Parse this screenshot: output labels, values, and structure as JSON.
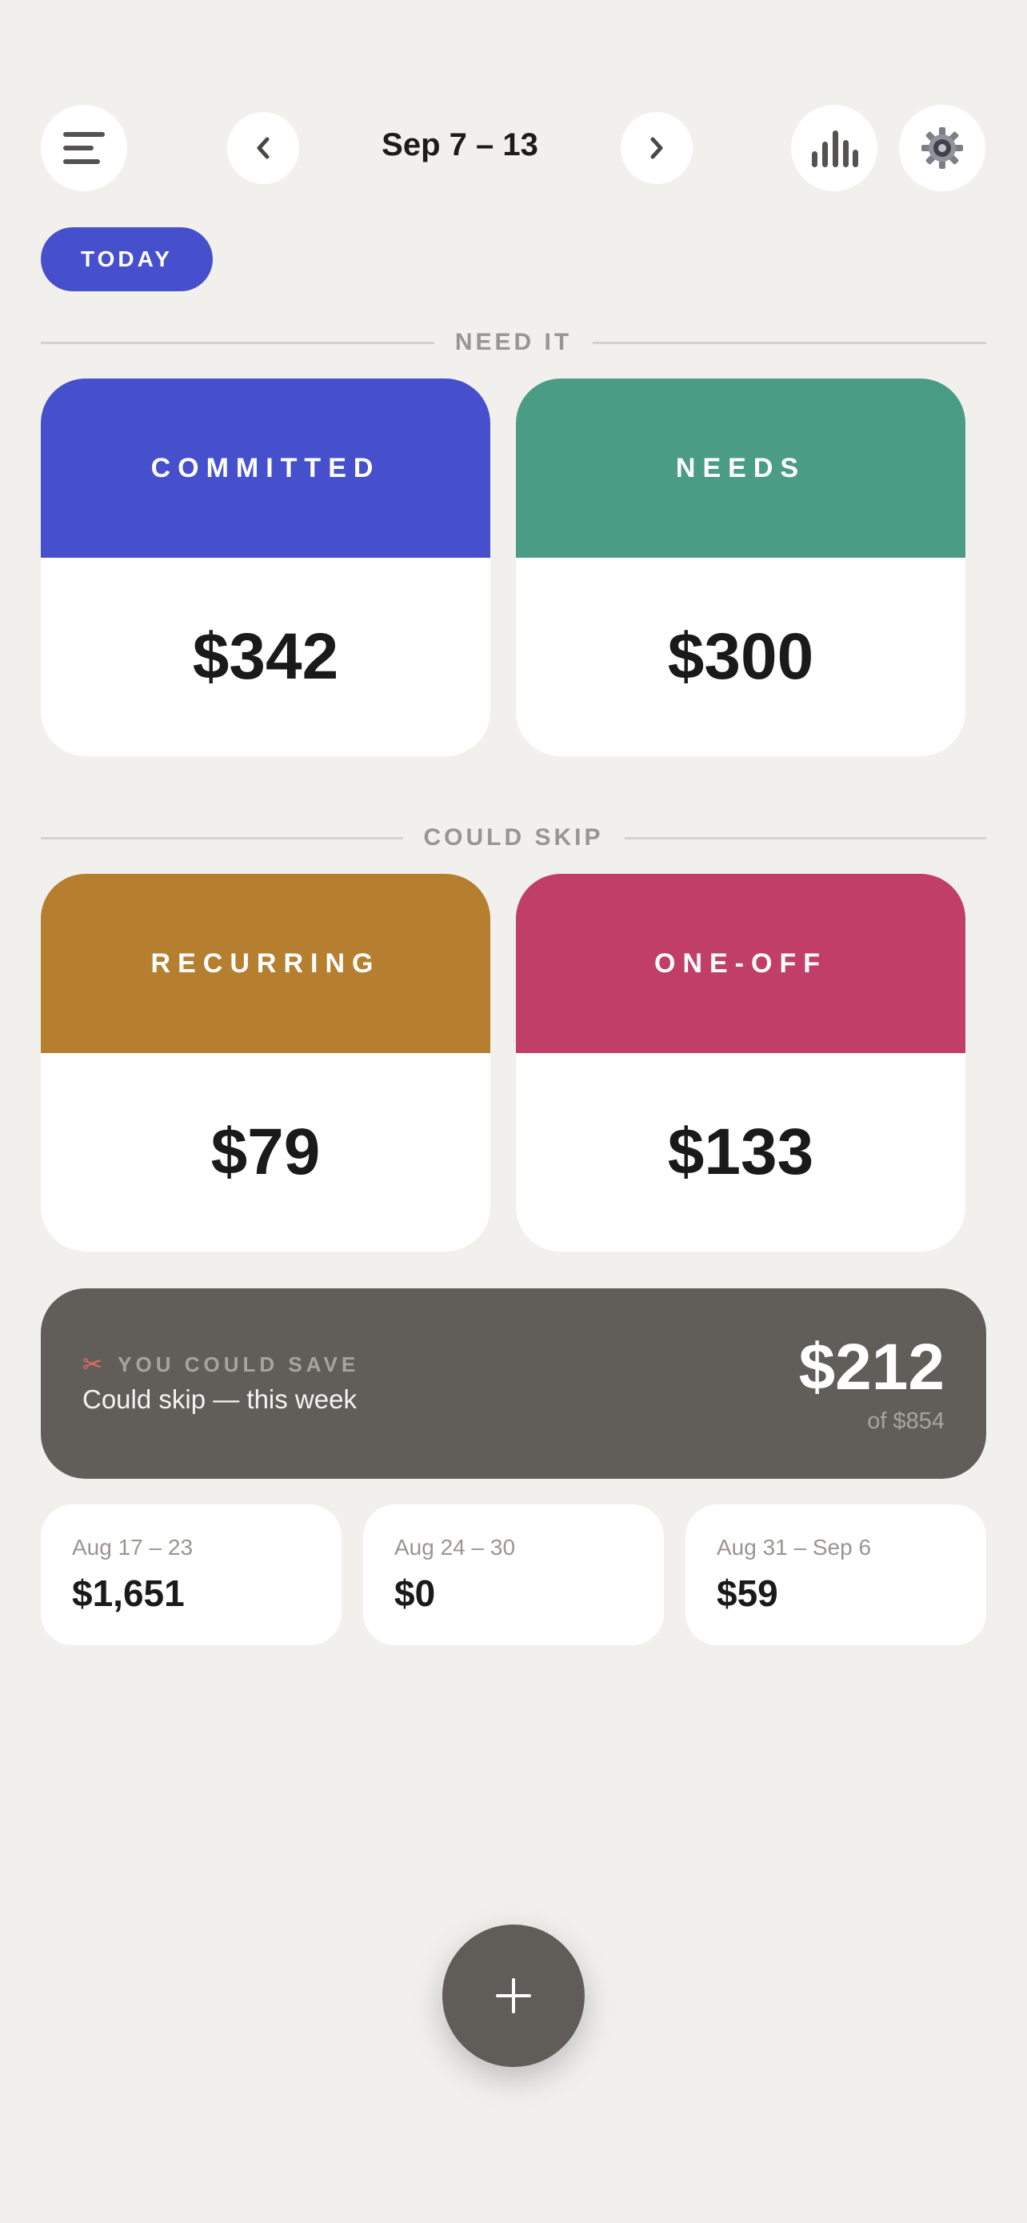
{
  "header": {
    "week_range": "Sep 7 – 13",
    "menu_icon": "hamburger-icon",
    "prev_icon": "chevron-left-icon",
    "next_icon": "chevron-right-icon",
    "stats_icon": "bar-chart-icon",
    "settings_icon": "gear-icon"
  },
  "today_label": "TODAY",
  "sections": {
    "need_it": "NEED IT",
    "could_skip": "COULD SKIP"
  },
  "categories": {
    "committed": {
      "label": "COMMITTED",
      "amount": "$342",
      "color": "#4650cc"
    },
    "needs": {
      "label": "NEEDS",
      "amount": "$300",
      "color": "#4a9c84"
    },
    "recurring": {
      "label": "RECURRING",
      "amount": "$79",
      "color": "#b67f2f"
    },
    "one_off": {
      "label": "ONE-OFF",
      "amount": "$133",
      "color": "#c13f66"
    }
  },
  "save": {
    "icon": "scissors-icon",
    "eyebrow": "YOU COULD SAVE",
    "subtitle": "Could skip — this week",
    "amount": "$212",
    "total": "of $854"
  },
  "past_weeks": [
    {
      "range": "Aug 17 – 23",
      "amount": "$1,651"
    },
    {
      "range": "Aug 24 – 30",
      "amount": "$0"
    },
    {
      "range": "Aug 31 – Sep 6",
      "amount": "$59"
    }
  ],
  "fab": {
    "icon": "plus-icon"
  }
}
